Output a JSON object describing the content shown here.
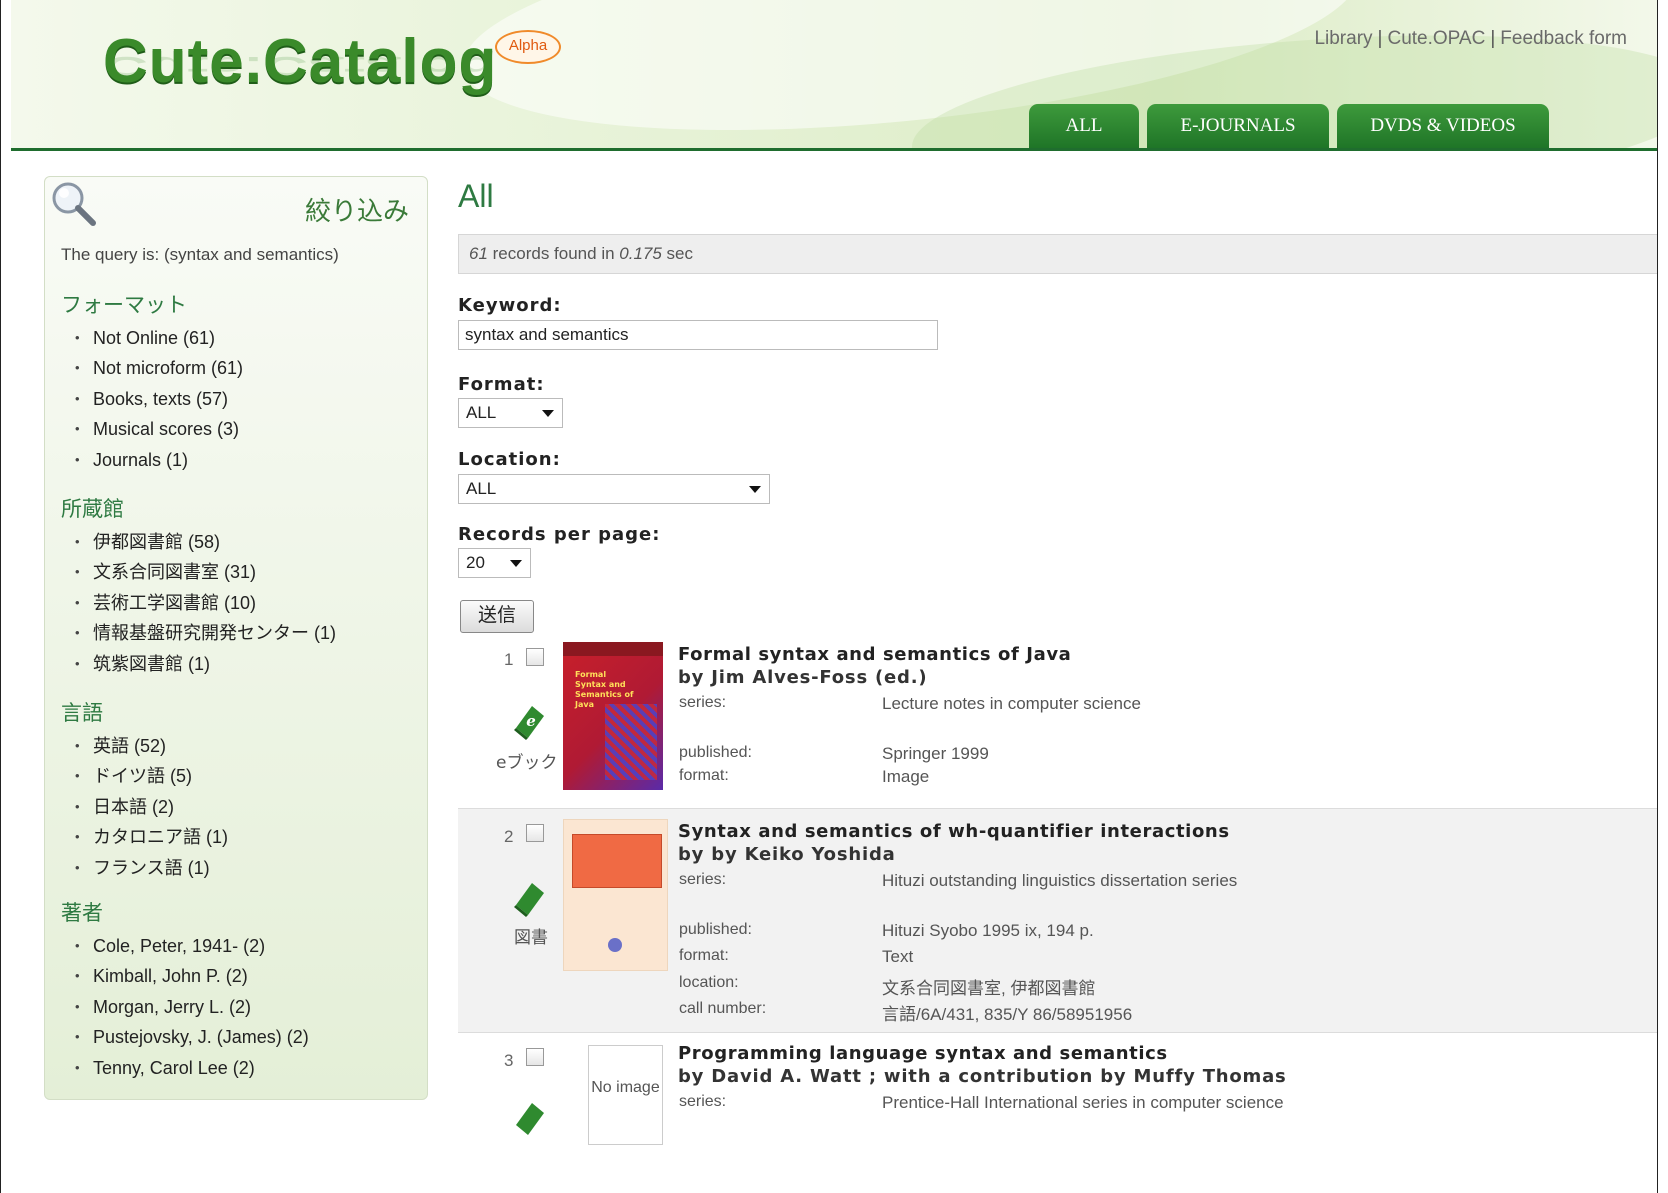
{
  "header": {
    "logo_text": "Cute.Catalog",
    "alpha_badge": "Alpha",
    "links": [
      "Library",
      "Cute.OPAC",
      "Feedback form"
    ],
    "link_separator": "|",
    "tabs": [
      "ALL",
      "E-JOURNALS",
      "DVDS & VIDEOS"
    ]
  },
  "sidebar": {
    "title": "絞り込み",
    "query_text": "The query is: (syntax and semantics)",
    "facets": [
      {
        "heading": "フォーマット",
        "items": [
          "Not Online (61)",
          "Not microform (61)",
          "Books, texts (57)",
          "Musical scores (3)",
          "Journals (1)"
        ]
      },
      {
        "heading": "所蔵館",
        "items": [
          "伊都図書館 (58)",
          "文系合同図書室 (31)",
          "芸術工学図書館 (10)",
          "情報基盤研究開発センター (1)",
          "筑紫図書館 (1)"
        ]
      },
      {
        "heading": "言語",
        "items": [
          "英語 (52)",
          "ドイツ語 (5)",
          "日本語 (2)",
          "カタロニア語 (1)",
          "フランス語 (1)"
        ]
      },
      {
        "heading": "著者",
        "items": [
          "Cole, Peter, 1941- (2)",
          "Kimball, John P. (2)",
          "Morgan, Jerry L. (2)",
          "Pustejovsky, J. (James) (2)",
          "Tenny, Carol Lee (2)"
        ]
      }
    ]
  },
  "main": {
    "title": "All",
    "summary": {
      "count": "61",
      "text1": " records found in ",
      "time": "0.175",
      "text2": " sec"
    },
    "keyword_label": "Keyword:",
    "keyword_value": "syntax and semantics",
    "format_label": "Format:",
    "format_value": "ALL",
    "location_label": "Location:",
    "location_value": "ALL",
    "rpp_label": "Records per page:",
    "rpp_value": "20",
    "submit_label": "送信"
  },
  "records": [
    {
      "num": "1",
      "type_label": "eブック",
      "title": "Formal syntax and semantics of Java",
      "by": "by Jim Alves-Foss (ed.)",
      "cover_text": "Formal Syntax and Semantics of Java",
      "fields": [
        {
          "k": "series:",
          "v": "Lecture notes in computer science"
        },
        {
          "k": "published:",
          "v": "Springer 1999"
        },
        {
          "k": "format:",
          "v": "Image"
        }
      ]
    },
    {
      "num": "2",
      "type_label": "図書",
      "title": "Syntax and semantics of wh-quantifier interactions",
      "by": "by by Keiko Yoshida",
      "fields": [
        {
          "k": "series:",
          "v": "Hituzi outstanding linguistics dissertation series"
        },
        {
          "k": "published:",
          "v": "Hituzi Syobo 1995 ix, 194 p."
        },
        {
          "k": "format:",
          "v": "Text"
        },
        {
          "k": "location:",
          "v": "文系合同図書室, 伊都図書館"
        },
        {
          "k": "call number:",
          "v": "言語/6A/431, 835/Y 86/58951956"
        }
      ]
    },
    {
      "num": "3",
      "title": "Programming language syntax and semantics",
      "by": "by David A. Watt ; with a contribution by Muffy Thomas",
      "cover_text": "No image",
      "fields": [
        {
          "k": "series:",
          "v": "Prentice-Hall International series in computer science"
        }
      ]
    }
  ]
}
